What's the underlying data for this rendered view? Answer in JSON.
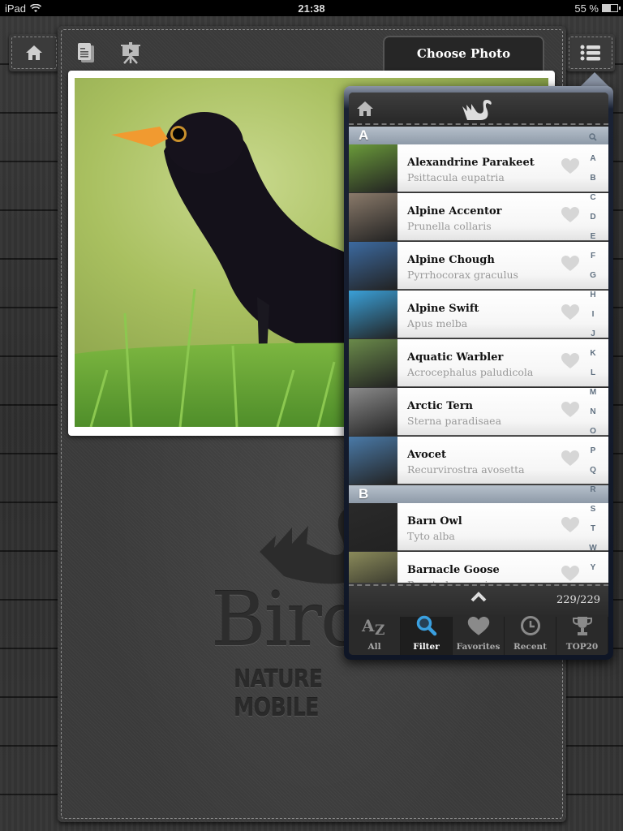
{
  "status_bar": {
    "device": "iPad",
    "time": "21:38",
    "battery": "55 %",
    "battery_level": 0.55
  },
  "toolbar": {
    "home_icon": "home-icon",
    "pages_icon": "document-icon",
    "slideshow_icon": "slideshow-icon",
    "choose_photo_label": "Choose Photo",
    "list_icon": "list-icon"
  },
  "logo": {
    "title": "Bird",
    "subtitle": "NATURE MOBILE"
  },
  "popover": {
    "header": {
      "home_icon": "home-icon",
      "logo_icon": "swan-icon"
    },
    "sections": [
      {
        "letter": "A",
        "items": [
          {
            "name": "Alexandrine Parakeet",
            "latin": "Psittacula eupatria",
            "thumb_color": "#6a9a3a"
          },
          {
            "name": "Alpine Accentor",
            "latin": "Prunella collaris",
            "thumb_color": "#8a7a6a"
          },
          {
            "name": "Alpine Chough",
            "latin": "Pyrrhocorax graculus",
            "thumb_color": "#3c6aa0"
          },
          {
            "name": "Alpine Swift",
            "latin": "Apus melba",
            "thumb_color": "#3aa0d8"
          },
          {
            "name": "Aquatic Warbler",
            "latin": "Acrocephalus paludicola",
            "thumb_color": "#6a8a4a"
          },
          {
            "name": "Arctic Tern",
            "latin": "Sterna paradisaea",
            "thumb_color": "#8a8a8a"
          },
          {
            "name": "Avocet",
            "latin": "Recurvirostra avosetta",
            "thumb_color": "#4a7aa8"
          }
        ]
      },
      {
        "letter": "B",
        "items": [
          {
            "name": "Barn Owl",
            "latin": "Tyto alba",
            "thumb_color": "#2a2a2a"
          },
          {
            "name": "Barnacle Goose",
            "latin": "Branta leucopsis",
            "thumb_color": "#8a8a5a"
          }
        ]
      }
    ],
    "index": [
      "search",
      "A",
      "B",
      "C",
      "D",
      "E",
      "F",
      "G",
      "H",
      "I",
      "J",
      "K",
      "L",
      "M",
      "N",
      "O",
      "P",
      "Q",
      "R",
      "S",
      "T",
      "W",
      "Y"
    ],
    "count": "229/229",
    "tabs": [
      {
        "label": "All",
        "icon": "az-icon",
        "active": false
      },
      {
        "label": "Filter",
        "icon": "search-icon",
        "active": true
      },
      {
        "label": "Favorites",
        "icon": "heart-icon",
        "active": false
      },
      {
        "label": "Recent",
        "icon": "clock-icon",
        "active": false
      },
      {
        "label": "TOP20",
        "icon": "trophy-icon",
        "active": false
      }
    ]
  },
  "colors": {
    "accent_blue": "#3aa0e0",
    "section_header": "#9aa6b4",
    "popover_border": "#0f1626"
  }
}
